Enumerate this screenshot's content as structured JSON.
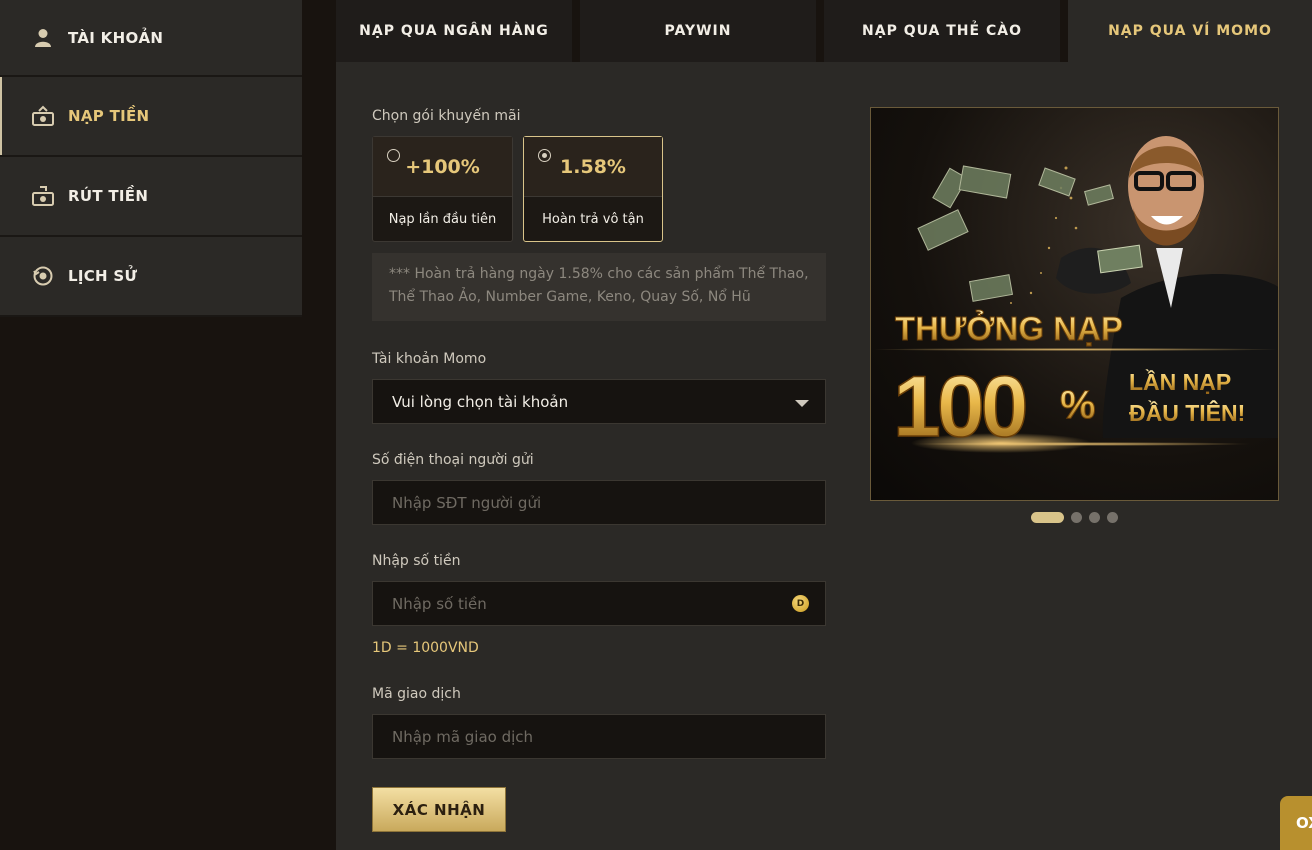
{
  "sidebar": {
    "items": [
      {
        "label": "TÀI KHOẢN",
        "icon": "user-icon"
      },
      {
        "label": "NẠP TIỀN",
        "icon": "deposit-icon"
      },
      {
        "label": "RÚT TIỀN",
        "icon": "withdraw-icon"
      },
      {
        "label": "LỊCH SỬ",
        "icon": "history-icon"
      }
    ],
    "active_index": 1
  },
  "tabs": [
    {
      "label": "NẠP QUA NGÂN HÀNG"
    },
    {
      "label": "PAYWIN"
    },
    {
      "label": "NẠP QUA THẺ CÀO"
    },
    {
      "label": "NẠP QUA VÍ MOMO"
    }
  ],
  "active_tab": 3,
  "form": {
    "promo_label": "Chọn gói khuyến mãi",
    "promos": [
      {
        "value": "+100%",
        "caption": "Nạp lần đầu tiên",
        "selected": false
      },
      {
        "value": "1.58%",
        "caption": "Hoàn trả vô tận",
        "selected": true
      }
    ],
    "promo_note": "*** Hoàn trả hàng ngày 1.58% cho các sản phẩm Thể Thao, Thể Thao Ảo, Number Game, Keno, Quay Số, Nổ Hũ",
    "account_label": "Tài khoản Momo",
    "account_select_value": "Vui lòng chọn tài khoản",
    "phone_label": "Số điện thoại người gửi",
    "phone_placeholder": "Nhập SĐT người gửi",
    "amount_label": "Nhập số tiền",
    "amount_placeholder": "Nhập số tiền",
    "coin_symbol": "D",
    "rate_text": "1D = 1000VND",
    "txn_label": "Mã giao dịch",
    "txn_placeholder": "Nhập mã giao dịch",
    "submit_label": "XÁC NHẬN"
  },
  "banner": {
    "title": "THƯỞNG NẠP",
    "big_number": "100",
    "percent": "%",
    "line1": "LẦN NẠP",
    "line2": "ĐẦU TIÊN!",
    "slides": 4,
    "active_slide": 0
  },
  "floater_text": "OX",
  "colors": {
    "accent": "#e6c77a",
    "panel": "#2b2926",
    "background": "#18130f"
  }
}
